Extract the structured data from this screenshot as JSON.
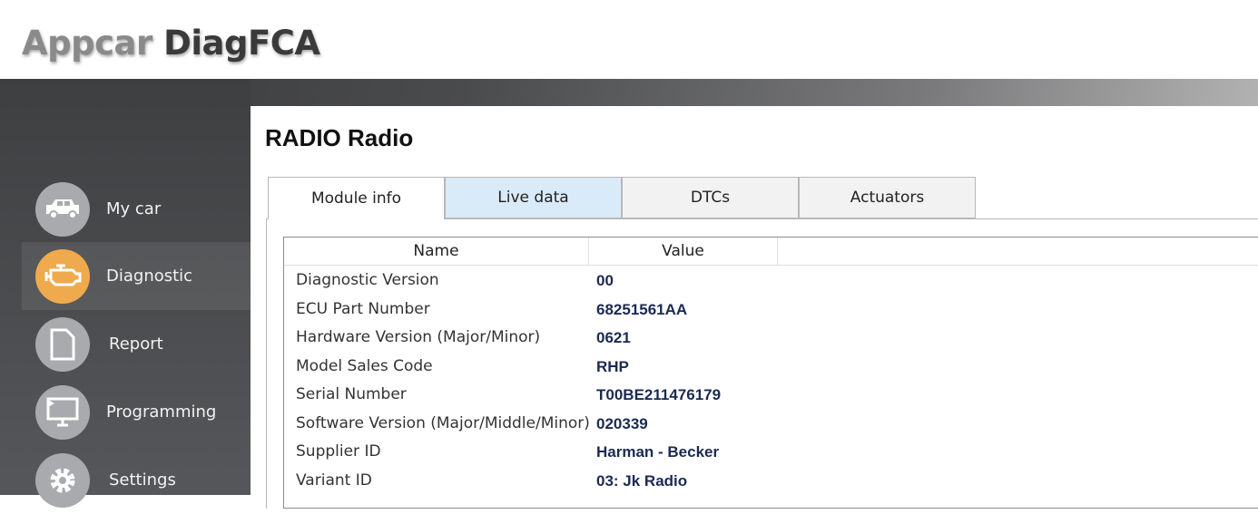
{
  "app": {
    "logo_part1": "Appcar",
    "logo_part2": "DiagFCA"
  },
  "sidebar": {
    "items": [
      {
        "label": "My car",
        "icon": "car-icon",
        "active": false
      },
      {
        "label": "Diagnostic",
        "icon": "engine-icon",
        "active": true
      },
      {
        "label": "Report",
        "icon": "document-icon",
        "active": false
      },
      {
        "label": "Programming",
        "icon": "monitor-icon",
        "active": false
      },
      {
        "label": "Settings",
        "icon": "gear-icon",
        "active": false
      }
    ]
  },
  "main": {
    "title": "RADIO Radio",
    "tabs": [
      {
        "label": "Module info"
      },
      {
        "label": "Live data"
      },
      {
        "label": "DTCs"
      },
      {
        "label": "Actuators"
      }
    ],
    "table": {
      "columns": [
        "Name",
        "Value"
      ],
      "rows": [
        {
          "name": "Diagnostic Version",
          "value": "00"
        },
        {
          "name": "ECU Part Number",
          "value": "68251561AA"
        },
        {
          "name": "Hardware Version (Major/Minor)",
          "value": "0621"
        },
        {
          "name": "Model Sales Code",
          "value": "RHP"
        },
        {
          "name": "Serial Number",
          "value": "T00BE211476179"
        },
        {
          "name": "Software Version (Major/Middle/Minor)",
          "value": "020339"
        },
        {
          "name": "Supplier ID",
          "value": "Harman - Becker"
        },
        {
          "name": "Variant ID",
          "value": "03: Jk Radio"
        }
      ]
    }
  },
  "colors": {
    "accent": "#efaa4d",
    "value_text": "#1b2a52",
    "tab_hover": "#d9eaf8"
  }
}
